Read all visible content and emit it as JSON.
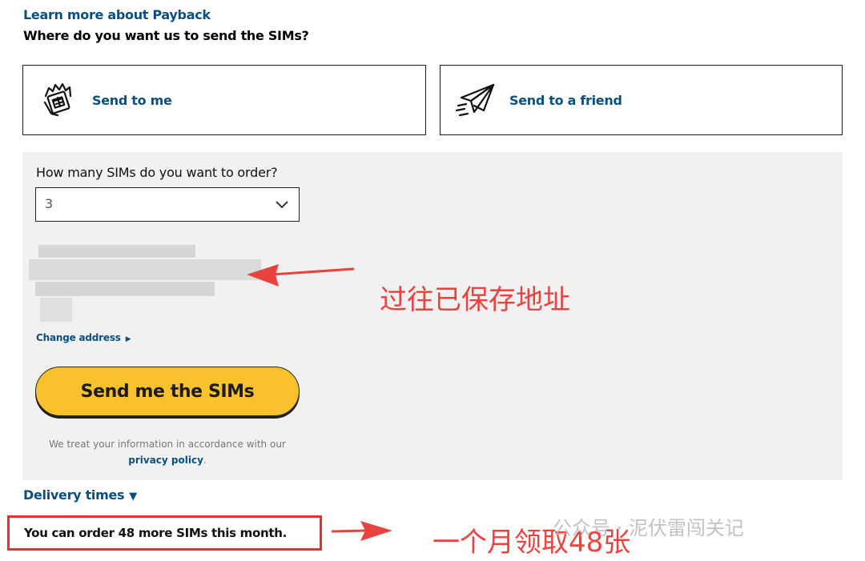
{
  "header": {
    "learn_link": "Learn more about Payback",
    "question": "Where do you want us to send the SIMs?"
  },
  "options": [
    {
      "label": "Send to me",
      "icon": "hand-sim-icon"
    },
    {
      "label": "Send to a friend",
      "icon": "paper-plane-icon"
    }
  ],
  "quantity": {
    "label": "How many SIMs do you want to order?",
    "value": "3"
  },
  "address": {
    "change_label": "Change address"
  },
  "send_button": "Send me the SIMs",
  "privacy": {
    "text_before": "We treat your information in accordance with our",
    "link": "privacy policy",
    "text_after": "."
  },
  "delivery_label": "Delivery times",
  "limit_text": "You can order 48 more SIMs this month.",
  "annotations": {
    "saved_address": "过往已保存地址",
    "monthly_limit": "一个月领取48张"
  },
  "watermark": "公众号 · 泥伏雷闯关记",
  "colors": {
    "link_blue": "#0b4f7e",
    "button_yellow": "#f9c22c",
    "annotation_red": "#e8302c",
    "panel_grey": "#f1f1f1"
  }
}
